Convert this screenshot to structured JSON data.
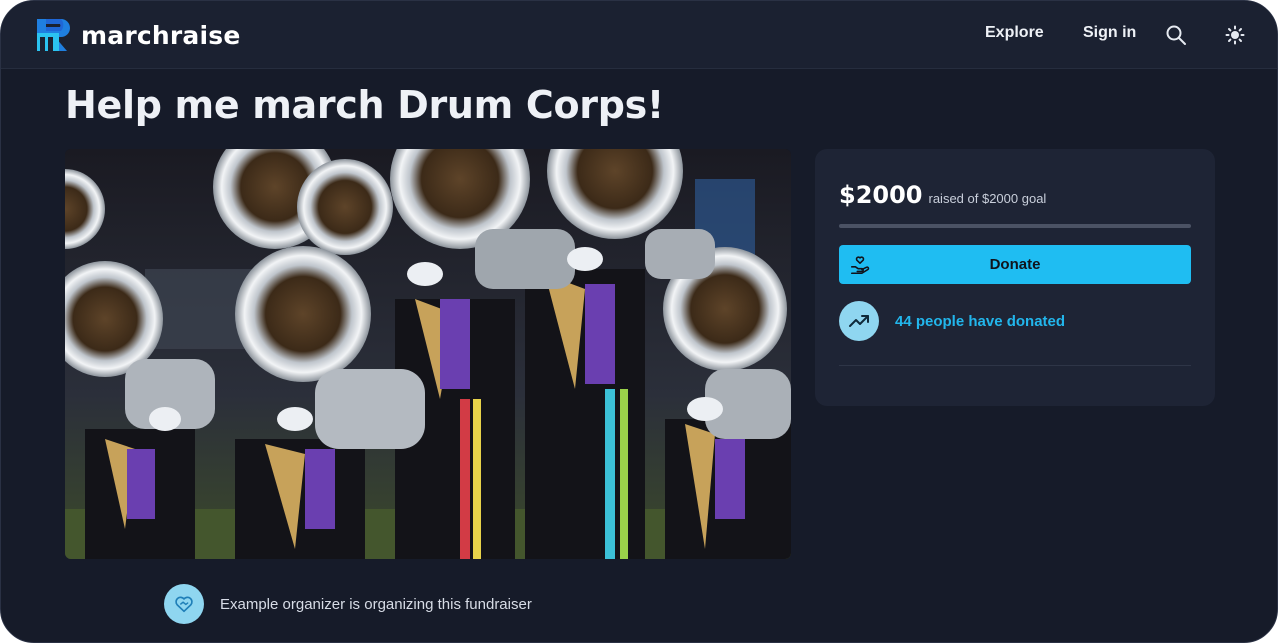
{
  "brand": {
    "name": "marchraise",
    "accent": "#1fbdf2"
  },
  "nav": {
    "explore_label": "Explore",
    "signin_label": "Sign in",
    "search_icon": "search-icon",
    "theme_icon": "sun-icon"
  },
  "fundraiser": {
    "title": "Help me march Drum Corps!",
    "image_alt": "Drum corps brass line playing silver horns in purple and gold uniforms",
    "raised_amount": "$2000",
    "goal_text": "raised of $2000 goal",
    "progress_fraction": 1.0,
    "donate_label": "Donate",
    "donors_text": "44 people have donated",
    "organizer_text": "Example organizer is organizing this fundraiser"
  },
  "colors": {
    "background": "#161b29",
    "card": "#1e2435",
    "donate_button": "#1fbdf2",
    "donors_text": "#22b6ec"
  }
}
